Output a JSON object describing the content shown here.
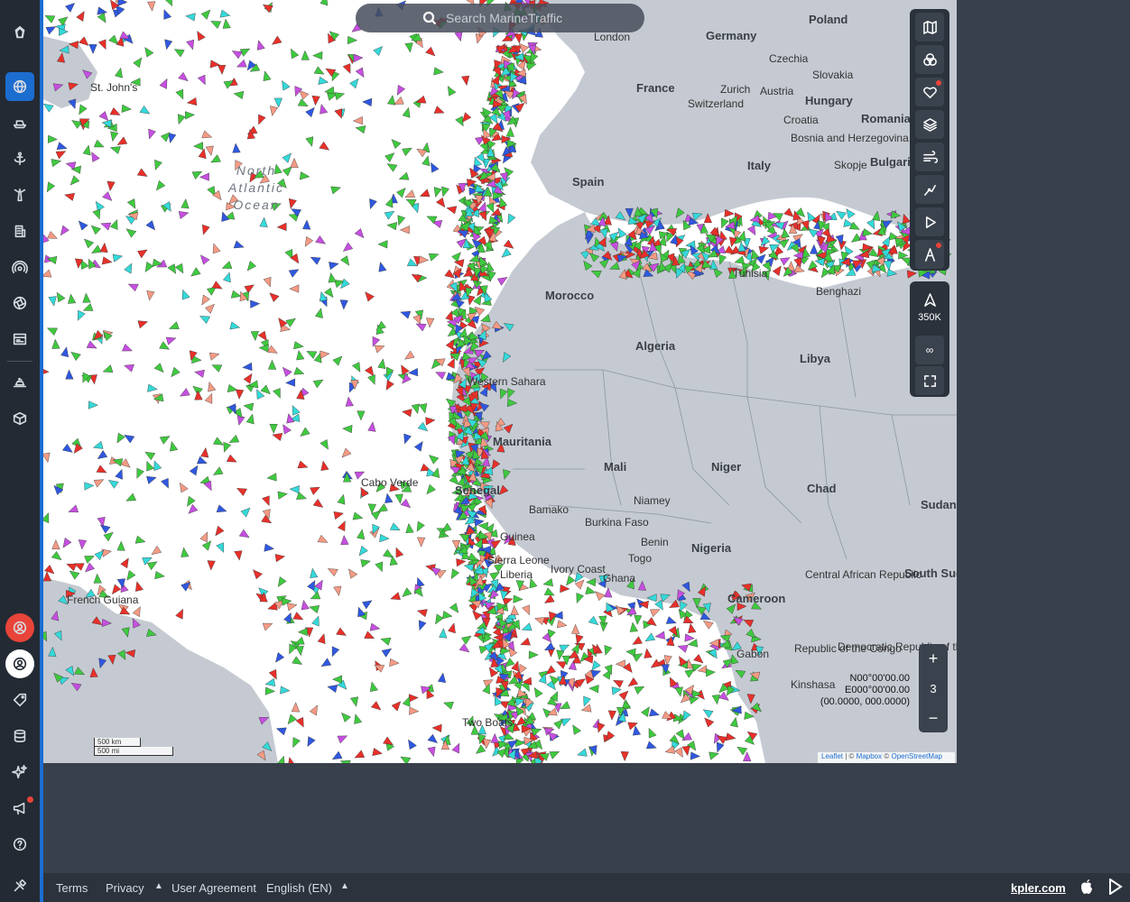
{
  "search": {
    "placeholder": "Search MarineTraffic"
  },
  "sidebar": {
    "items": [
      "map-icon",
      "globe-icon",
      "vessel-icon",
      "port-icon",
      "lighthouse-icon",
      "building-icon",
      "radar-icon",
      "aperture-icon",
      "news-icon",
      "ship-icon",
      "box-icon",
      "account-red-icon",
      "account-icon",
      "tag-icon",
      "database-icon",
      "sparkle-icon",
      "megaphone-icon",
      "help-icon",
      "tools-icon"
    ]
  },
  "controls": {
    "vessel_count": "350K",
    "zoom_level": "3",
    "infinity": "∞"
  },
  "coords": {
    "lat": "N00°00'00.00",
    "lon": "E000°00'00.00",
    "decimal": "(00.0000, 000.0000)"
  },
  "scale": {
    "km": "500 km",
    "mi": "500 mi"
  },
  "attribution": {
    "leaflet": "Leaflet",
    "sep1": " | © ",
    "mapbox": "Mapbox",
    "sep2": " © ",
    "osm": "OpenStreetMap"
  },
  "footer": {
    "terms": "Terms",
    "privacy": "Privacy",
    "agreement": "User Agreement",
    "language": "English (EN)",
    "brand": "kpler.com"
  },
  "map": {
    "ocean_name": "North\nAtlantic\nOcean",
    "labels": [
      {
        "text": "Poland"
      },
      {
        "text": "Germany"
      },
      {
        "text": "Czechia"
      },
      {
        "text": "Slovakia"
      },
      {
        "text": "France"
      },
      {
        "text": "Zurich"
      },
      {
        "text": "Austria"
      },
      {
        "text": "Hungary"
      },
      {
        "text": "Switzerland"
      },
      {
        "text": "Romania"
      },
      {
        "text": "Croatia"
      },
      {
        "text": "Bosnia and Herzegovina"
      },
      {
        "text": "Skopje"
      },
      {
        "text": "Bulgaria"
      },
      {
        "text": "Spain"
      },
      {
        "text": "Italy"
      },
      {
        "text": "London"
      },
      {
        "text": "Morocco"
      },
      {
        "text": "Algeria"
      },
      {
        "text": "Libya"
      },
      {
        "text": "Tunisia"
      },
      {
        "text": "Benghazi"
      },
      {
        "text": "Western Sahara"
      },
      {
        "text": "Mauritania"
      },
      {
        "text": "Mali"
      },
      {
        "text": "Niger"
      },
      {
        "text": "Chad"
      },
      {
        "text": "Sudan"
      },
      {
        "text": "Senegal"
      },
      {
        "text": "Cabo Verde"
      },
      {
        "text": "Bamako"
      },
      {
        "text": "Niamey"
      },
      {
        "text": "Burkina Faso"
      },
      {
        "text": "Guinea"
      },
      {
        "text": "Ivory Coast"
      },
      {
        "text": "Ghana"
      },
      {
        "text": "Benin"
      },
      {
        "text": "Togo"
      },
      {
        "text": "Nigeria"
      },
      {
        "text": "Cameroon"
      },
      {
        "text": "Central African Republic"
      },
      {
        "text": "South Sudan"
      },
      {
        "text": "Democratic Republic of the Congo"
      },
      {
        "text": "Republic of the Congo"
      },
      {
        "text": "Gabon"
      },
      {
        "text": "Kinshasa"
      },
      {
        "text": "French Guiana"
      },
      {
        "text": "Two Boats"
      },
      {
        "text": "St. John's"
      },
      {
        "text": "Sierra Leone"
      },
      {
        "text": "Liberia"
      }
    ]
  }
}
